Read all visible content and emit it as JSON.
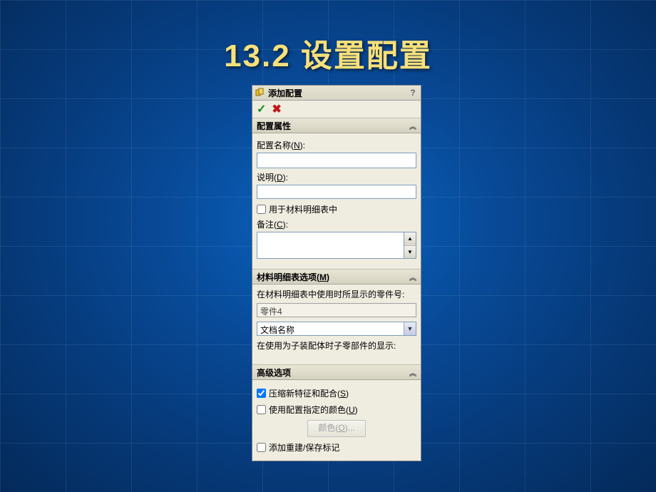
{
  "slide_title": "13.2  设置配置",
  "panel": {
    "title": "添加配置",
    "help": "?",
    "ok": "✓",
    "cancel": "✖"
  },
  "config_props": {
    "header": "配置属性",
    "name_label_pre": "配置名称(",
    "name_hotkey": "N",
    "name_label_post": "):",
    "name_value": "",
    "desc_label_pre": "说明(",
    "desc_hotkey": "D",
    "desc_label_post": "):",
    "desc_value": "",
    "use_in_bom_label": "用于材料明细表中",
    "use_in_bom_checked": false,
    "notes_label_pre": "备注(",
    "notes_hotkey": "C",
    "notes_label_post": "):",
    "notes_value": ""
  },
  "bom_opts": {
    "header_pre": "材料明细表选项(",
    "header_hotkey": "M",
    "header_post": ")",
    "help1": "在材料明细表中使用时所显示的零件号:",
    "part_number": "零件4",
    "select_value": "文档名称",
    "help2": "在使用为子装配体时子零部件的显示:"
  },
  "adv": {
    "header": "高级选项",
    "suppress_label_pre": "压缩新特征和配合(",
    "suppress_hotkey": "S",
    "suppress_label_post": ")",
    "suppress_checked": true,
    "usecolor_label_pre": "使用配置指定的颜色(",
    "usecolor_hotkey": "U",
    "usecolor_label_post": ")",
    "usecolor_checked": false,
    "color_button_pre": "颜色(",
    "color_button_hotkey": "O",
    "color_button_post": ")...",
    "addmark_label": "添加重建/保存标记",
    "addmark_checked": false
  }
}
